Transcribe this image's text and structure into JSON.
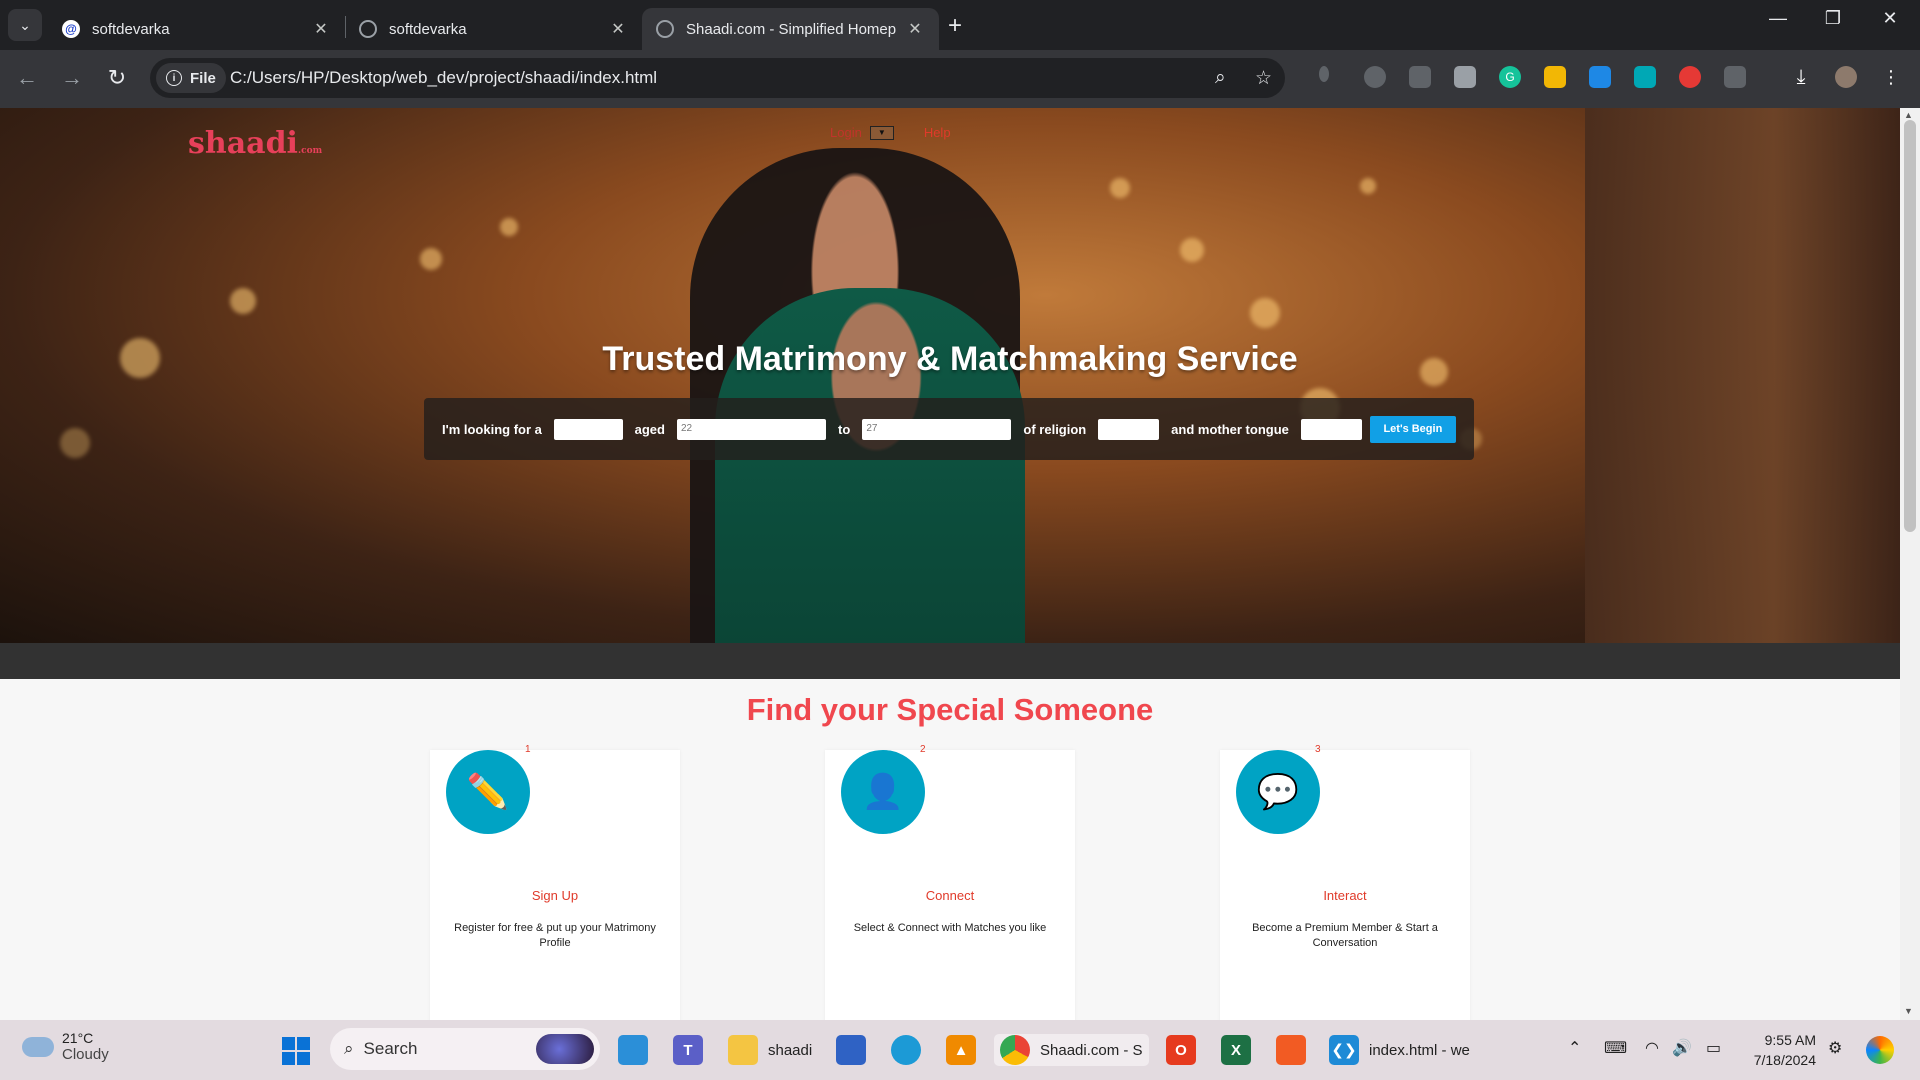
{
  "browser": {
    "tabs": [
      {
        "title": "softdevarka",
        "active": false
      },
      {
        "title": "softdevarka",
        "active": false
      },
      {
        "title": "Shaadi.com - Simplified Homep",
        "active": true
      }
    ],
    "chip_label": "File",
    "url": "C:/Users/HP/Desktop/web_dev/project/shaadi/index.html"
  },
  "site": {
    "logo": "shaadi",
    "logo_suffix": ".com",
    "nav": {
      "login": "Login",
      "help": "Help"
    },
    "headline": "Trusted Matrimony & Matchmaking Service",
    "search": {
      "looking_for": "I'm looking for a",
      "aged": "aged",
      "age_from": "22",
      "to": "to",
      "age_to": "27",
      "religion": "of religion",
      "mother_tongue": "and mother tongue",
      "begin_button": "Let's Begin"
    },
    "section_title": "Find your Special Someone",
    "steps": [
      {
        "num": "1",
        "title": "Sign Up",
        "desc": "Register for free & put up your Matrimony Profile",
        "icon": "pencil-icon"
      },
      {
        "num": "2",
        "title": "Connect",
        "desc": "Select & Connect with Matches you like",
        "icon": "user-icon"
      },
      {
        "num": "3",
        "title": "Interact",
        "desc": "Become a Premium Member & Start a Conversation",
        "icon": "chat-bubble-icon"
      }
    ]
  },
  "taskbar": {
    "weather": {
      "temp": "21°C",
      "condition": "Cloudy"
    },
    "search_label": "Search",
    "apps": {
      "explorer_label": "shaadi",
      "chrome_label": "Shaadi.com - S",
      "vscode_label": "index.html - we"
    },
    "clock": {
      "time": "9:55 AM",
      "date": "7/18/2024"
    }
  },
  "colors": {
    "accent": "#f0474e",
    "cta": "#11a0e6",
    "icon_circle": "#00a3c4"
  }
}
